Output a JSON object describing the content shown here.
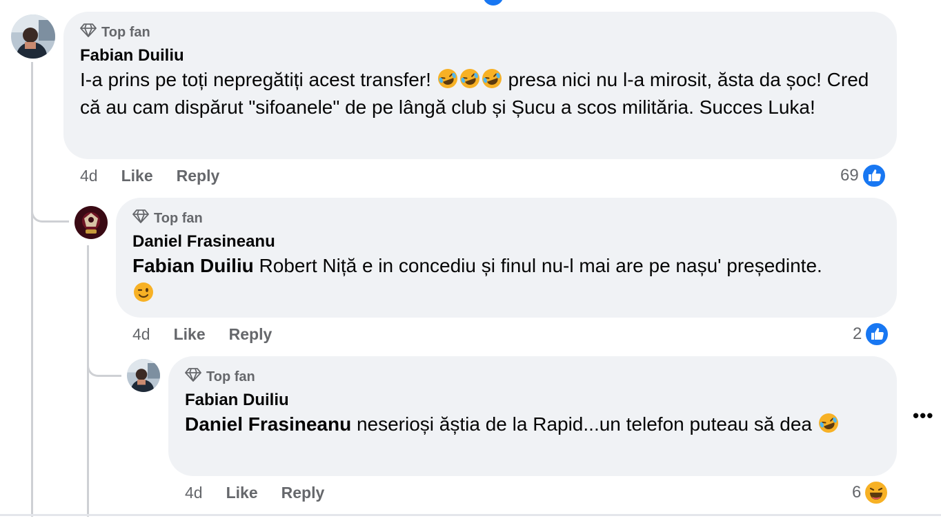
{
  "comments": [
    {
      "badge": "Top fan",
      "author": "Fabian Duiliu",
      "text_1": "I-a prins pe toți nepregătiți acest transfer! ",
      "text_2": " presa nici nu l-a mirosit, ăsta da șoc! Cred că au cam dispărut \"sifoanele\" de pe lângă club și Șucu a scos milităria. Succes Luka!",
      "time": "4d",
      "like_label": "Like",
      "reply_label": "Reply",
      "reaction_count": "69",
      "reaction_icon": "like-icon"
    },
    {
      "badge": "Top fan",
      "author": "Daniel Frasineanu",
      "mention": "Fabian Duiliu",
      "text": " Robert Niță e in concediu și finul nu-l mai are pe nașu' președinte.",
      "time": "4d",
      "like_label": "Like",
      "reply_label": "Reply",
      "reaction_count": "2",
      "reaction_icon": "like-icon"
    },
    {
      "badge": "Top fan",
      "author": "Fabian Duiliu",
      "mention": "Daniel Frasineanu",
      "text": " neserioși ăștia de la Rapid...un telefon puteau să dea",
      "time": "4d",
      "like_label": "Like",
      "reply_label": "Reply",
      "reaction_count": "6",
      "reaction_icon": "haha-icon"
    }
  ],
  "more_label": "•••",
  "colors": {
    "bubble": "#f0f2f5",
    "secondary_text": "#65676b",
    "like_blue": "#1877f2",
    "emoji_yellow": "#f7b125"
  }
}
